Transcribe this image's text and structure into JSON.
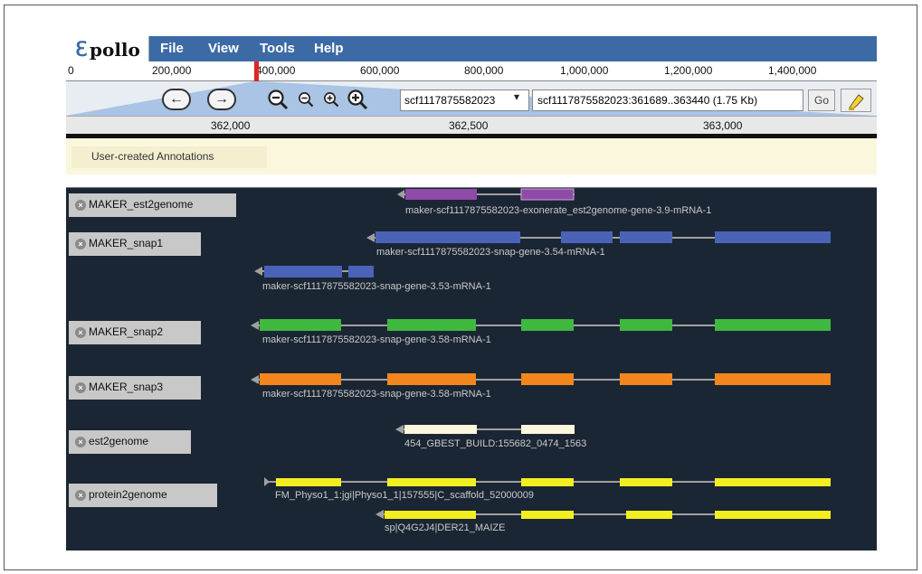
{
  "app": {
    "name": "pollo"
  },
  "menu": [
    "File",
    "View",
    "Tools",
    "Help"
  ],
  "overview": {
    "ticks": [
      "0",
      "200,000",
      "400,000",
      "600,000",
      "800,000",
      "1,000,000",
      "1,200,000",
      "1,400,000"
    ]
  },
  "nav": {
    "refseq": "scf1117875582023",
    "location": "scf1117875582023:361689..363440 (1.75 Kb)",
    "go_label": "Go",
    "back_icon": "arrow-left-icon",
    "forward_icon": "arrow-right-icon"
  },
  "detail_ruler": {
    "ticks": [
      "362,000",
      "362,500",
      "363,000"
    ]
  },
  "user_annotations": {
    "label": "User-created Annotations"
  },
  "tracks": [
    {
      "label": "MAKER_est2genome",
      "features": [
        "maker-scf1117875582023-exonerate_est2genome-gene-3.9-mRNA-1"
      ],
      "color": "#8e4ba8"
    },
    {
      "label": "MAKER_snap1",
      "features": [
        "maker-scf1117875582023-snap-gene-3.54-mRNA-1",
        "maker-scf1117875582023-snap-gene-3.53-mRNA-1"
      ],
      "color": "#4a63b8"
    },
    {
      "label": "MAKER_snap2",
      "features": [
        "maker-scf1117875582023-snap-gene-3.58-mRNA-1"
      ],
      "color": "#3fb83f"
    },
    {
      "label": "MAKER_snap3",
      "features": [
        "maker-scf1117875582023-snap-gene-3.58-mRNA-1"
      ],
      "color": "#f2861d"
    },
    {
      "label": "est2genome",
      "features": [
        "454_GBEST_BUILD:155682_0474_1563"
      ],
      "color": "#fbf6dc"
    },
    {
      "label": "protein2genome",
      "features": [
        "FM_Physo1_1:jgi|Physo1_1|157555|C_scaffold_52000009",
        "sp|Q4G2J4|DER21_MAIZE"
      ],
      "color": "#f3ee1f"
    }
  ]
}
